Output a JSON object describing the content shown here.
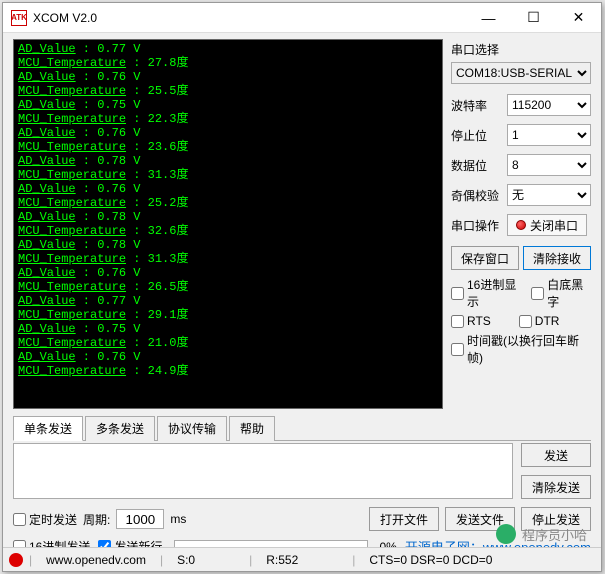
{
  "title": "XCOM V2.0",
  "terminal_lines": [
    "AD_Value : 0.77 V",
    "MCU Temperature : 27.8度",
    "AD_Value : 0.76 V",
    "MCU Temperature : 25.5度",
    "AD_Value : 0.75 V",
    "MCU Temperature : 22.3度",
    "AD_Value : 0.76 V",
    "MCU Temperature : 23.6度",
    "AD_Value : 0.78 V",
    "MCU Temperature : 31.3度",
    "AD_Value : 0.76 V",
    "MCU Temperature : 25.2度",
    "AD_Value : 0.78 V",
    "MCU Temperature : 32.6度",
    "AD_Value : 0.78 V",
    "MCU Temperature : 31.3度",
    "AD_Value : 0.76 V",
    "MCU Temperature : 26.5度",
    "AD_Value : 0.77 V",
    "MCU Temperature : 29.1度",
    "AD_Value : 0.75 V",
    "MCU Temperature : 21.0度",
    "AD_Value : 0.76 V",
    "MCU Temperature : 24.9度"
  ],
  "side": {
    "port_select_label": "串口选择",
    "port_value": "COM18:USB-SERIAL",
    "baud_label": "波特率",
    "baud_value": "115200",
    "stop_label": "停止位",
    "stop_value": "1",
    "data_label": "数据位",
    "data_value": "8",
    "parity_label": "奇偶校验",
    "parity_value": "无",
    "op_label": "串口操作",
    "op_button": "关闭串口",
    "save_btn": "保存窗口",
    "clear_btn": "清除接收",
    "hex_disp": "16进制显示",
    "white_bg": "白底黑字",
    "rts": "RTS",
    "dtr": "DTR",
    "timestamp": "时间戳(以换行回车断帧)"
  },
  "tabs": {
    "single": "单条发送",
    "multi": "多条发送",
    "proto": "协议传输",
    "help": "帮助"
  },
  "send": {
    "send_btn": "发送",
    "clear_btn": "清除发送"
  },
  "bottom": {
    "timed_send": "定时发送",
    "period_label": "周期:",
    "period_value": "1000",
    "period_unit": "ms",
    "open_file": "打开文件",
    "send_file": "发送文件",
    "stop_send": "停止发送",
    "hex_send": "16进制发送",
    "send_newline": "发送新行",
    "progress_pct": "0%",
    "link_text": "开源电子网：www.openedv.com"
  },
  "status": {
    "url": "www.openedv.com",
    "s": "S:0",
    "r": "R:552",
    "flags": "CTS=0 DSR=0 DCD=0"
  },
  "watermark": "程序员小哈"
}
